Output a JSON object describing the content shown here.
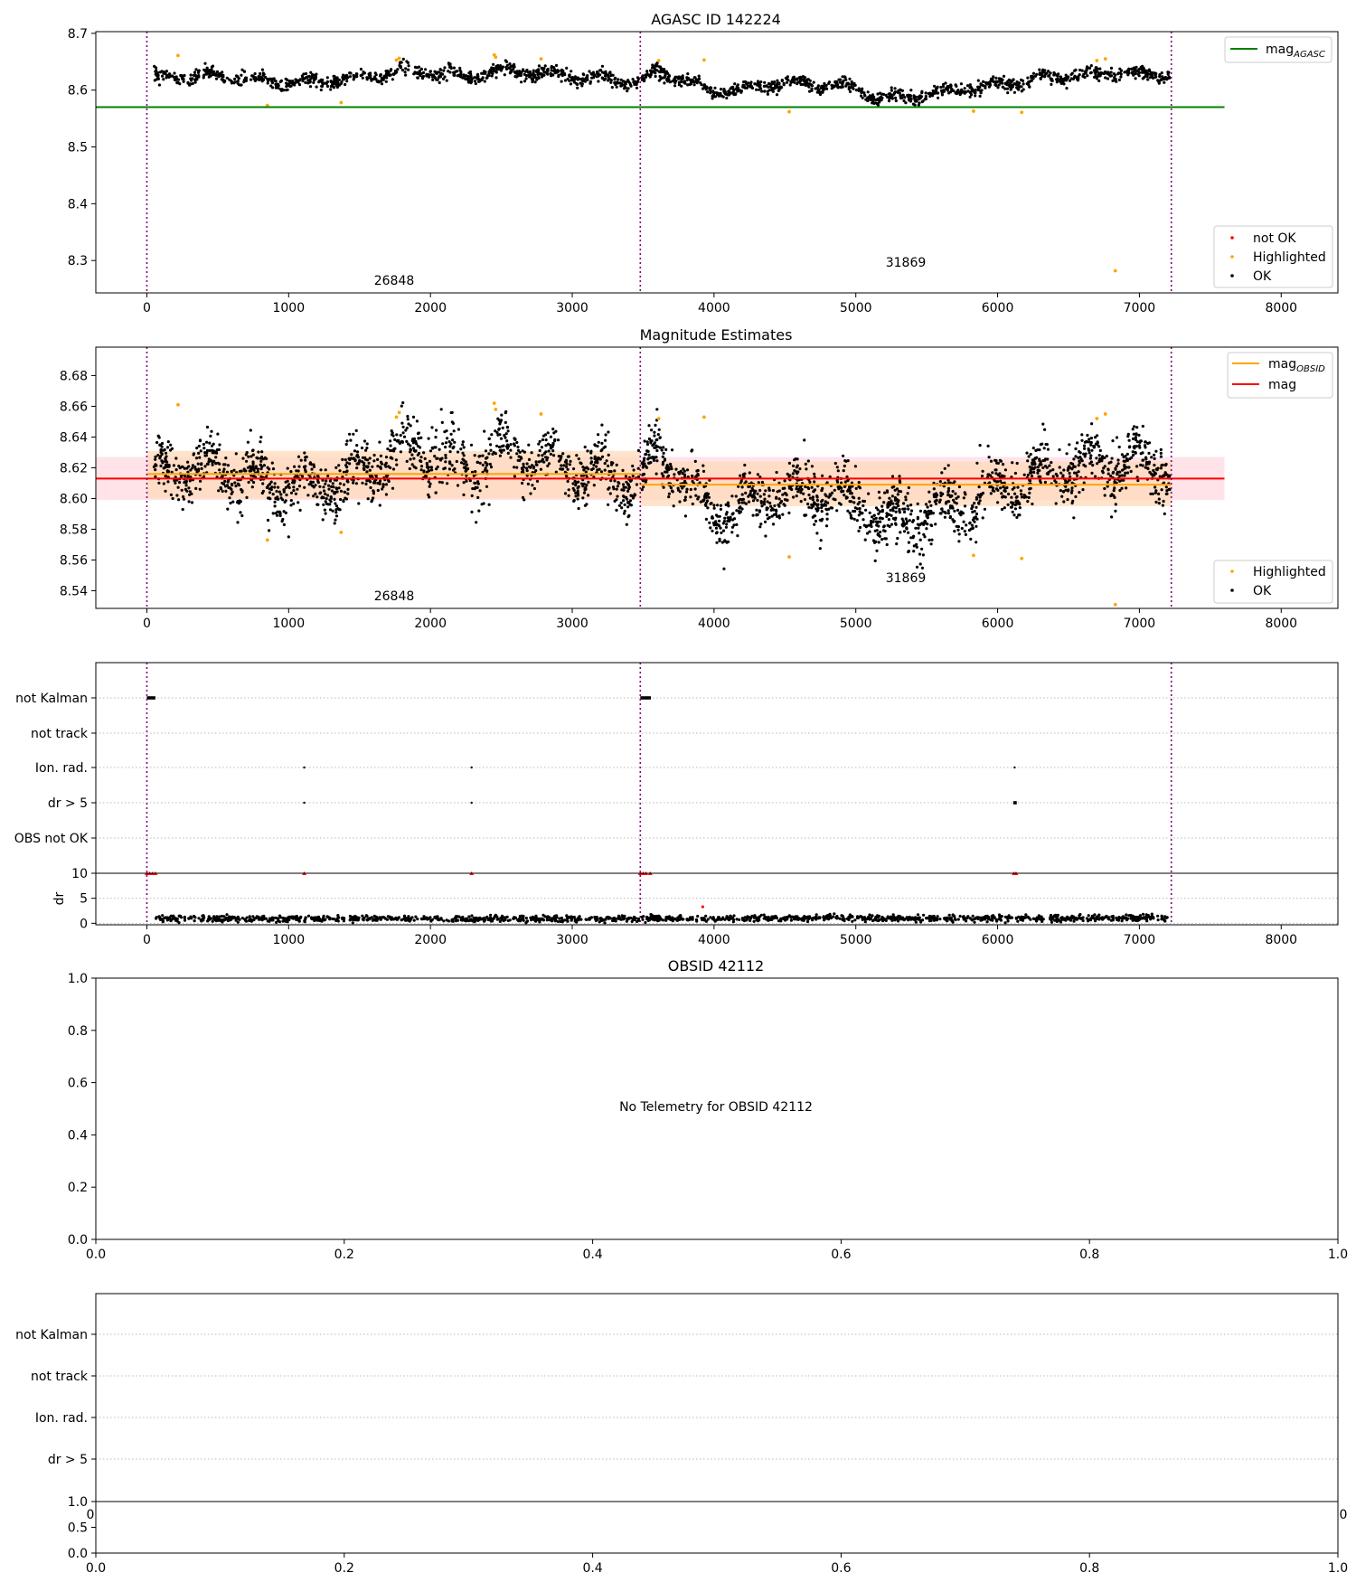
{
  "chart_data": [
    {
      "type": "scatter",
      "title": "AGASC ID 142224",
      "xlim": [
        -360,
        8400
      ],
      "ylim": [
        8.243,
        8.703
      ],
      "xticks": [
        "0",
        "1000",
        "2000",
        "3000",
        "4000",
        "5000",
        "6000",
        "7000",
        "8000"
      ],
      "xtick_values": [
        0,
        1000,
        2000,
        3000,
        4000,
        5000,
        6000,
        7000,
        8000
      ],
      "yticks": [
        "8.3",
        "8.4",
        "8.5",
        "8.6",
        "8.7"
      ],
      "ytick_values": [
        8.3,
        8.4,
        8.5,
        8.6,
        8.7
      ],
      "lines": [
        {
          "label": "mag",
          "label_sub": "AGASC",
          "y": 8.57,
          "x": [
            -360,
            7600
          ],
          "color": "#008000"
        }
      ],
      "obsid_boundaries": [
        0,
        3480,
        7225
      ],
      "obsid_labels": [
        {
          "text": "26848",
          "x": 1740,
          "y": 8.265
        },
        {
          "text": "31869",
          "x": 5350,
          "y": 8.297
        }
      ],
      "legends": [
        {
          "position": "upper-right",
          "entries": [
            {
              "label": "mag",
              "sub": "AGASC",
              "kind": "line",
              "color": "#008000"
            }
          ]
        },
        {
          "position": "lower-right",
          "entries": [
            {
              "label": "not OK",
              "kind": "dot",
              "color": "#ff0000"
            },
            {
              "label": "Highlighted",
              "kind": "dot",
              "color": "#ffa500"
            },
            {
              "label": "OK",
              "kind": "dot",
              "color": "#000000"
            }
          ]
        }
      ],
      "series": [
        {
          "name": "OK",
          "color": "#000000",
          "segments": [
            {
              "x_start": 50,
              "x_end": 3470,
              "n": 900,
              "profile": [
                [
                  50,
                  8.622
                ],
                [
                  500,
                  8.625
                ],
                [
                  1000,
                  8.612
                ],
                [
                  1500,
                  8.62
                ],
                [
                  1800,
                  8.635
                ],
                [
                  2300,
                  8.625
                ],
                [
                  2500,
                  8.635
                ],
                [
                  3000,
                  8.625
                ],
                [
                  3470,
                  8.615
                ]
              ],
              "spread": 0.011
            },
            {
              "x_start": 3490,
              "x_end": 7215,
              "n": 1000,
              "profile": [
                [
                  3490,
                  8.615
                ],
                [
                  3600,
                  8.635
                ],
                [
                  4000,
                  8.597
                ],
                [
                  4500,
                  8.612
                ],
                [
                  4900,
                  8.607
                ],
                [
                  5200,
                  8.585
                ],
                [
                  5600,
                  8.595
                ],
                [
                  6000,
                  8.61
                ],
                [
                  6300,
                  8.62
                ],
                [
                  6800,
                  8.63
                ],
                [
                  7215,
                  8.625
                ]
              ],
              "spread": 0.011
            }
          ]
        },
        {
          "name": "Highlighted",
          "color": "#ffa500",
          "points": [
            [
              220,
              8.661
            ],
            [
              850,
              8.573
            ],
            [
              1370,
              8.578
            ],
            [
              1760,
              8.653
            ],
            [
              1780,
              8.656
            ],
            [
              2450,
              8.662
            ],
            [
              2460,
              8.658
            ],
            [
              2780,
              8.655
            ],
            [
              3610,
              8.652
            ],
            [
              3930,
              8.653
            ],
            [
              4530,
              8.562
            ],
            [
              5830,
              8.563
            ],
            [
              6170,
              8.561
            ],
            [
              6700,
              8.652
            ],
            [
              6760,
              8.655
            ],
            [
              6830,
              8.282
            ]
          ]
        }
      ]
    },
    {
      "type": "scatter",
      "title": "Magnitude Estimates",
      "xlim": [
        -360,
        8400
      ],
      "ylim": [
        8.5285,
        8.6985
      ],
      "xticks": [
        "0",
        "1000",
        "2000",
        "3000",
        "4000",
        "5000",
        "6000",
        "7000",
        "8000"
      ],
      "xtick_values": [
        0,
        1000,
        2000,
        3000,
        4000,
        5000,
        6000,
        7000,
        8000
      ],
      "yticks": [
        "8.54",
        "8.56",
        "8.58",
        "8.60",
        "8.62",
        "8.64",
        "8.66",
        "8.68"
      ],
      "ytick_values": [
        8.54,
        8.56,
        8.58,
        8.6,
        8.62,
        8.64,
        8.66,
        8.68
      ],
      "lines": [
        {
          "label": "mag",
          "y": 8.613,
          "x": [
            -360,
            7600
          ],
          "color": "#ff0000",
          "band": [
            8.599,
            8.627
          ],
          "band_color": "#ffc0cb"
        },
        {
          "label": "mag",
          "label_sub": "OBSID",
          "segments": [
            {
              "x": [
                0,
                3480
              ],
              "y": 8.616,
              "band": [
                8.6,
                8.631
              ]
            },
            {
              "x": [
                3480,
                7225
              ],
              "y": 8.609,
              "band": [
                8.595,
                8.624
              ]
            }
          ],
          "color": "#ffa500",
          "band_color": "#ffdab9"
        }
      ],
      "obsid_boundaries": [
        0,
        3480,
        7225
      ],
      "obsid_labels": [
        {
          "text": "26848",
          "x": 1740,
          "y": 8.5335
        },
        {
          "text": "31869",
          "x": 5350,
          "y": 8.546
        }
      ],
      "legends": [
        {
          "position": "upper-right",
          "entries": [
            {
              "label": "mag",
              "sub": "OBSID",
              "kind": "line",
              "color": "#ffa500"
            },
            {
              "label": "mag",
              "kind": "line",
              "color": "#ff0000"
            }
          ]
        },
        {
          "position": "lower-right",
          "entries": [
            {
              "label": "Highlighted",
              "kind": "dot",
              "color": "#ffa500"
            },
            {
              "label": "OK",
              "kind": "dot",
              "color": "#000000"
            }
          ]
        }
      ],
      "series": [
        {
          "name": "OK",
          "color": "#000000",
          "segments": [
            {
              "x_start": 50,
              "x_end": 3470,
              "n": 1300,
              "profile": [
                [
                  50,
                  8.617
                ],
                [
                  500,
                  8.62
                ],
                [
                  1000,
                  8.605
                ],
                [
                  1500,
                  8.615
                ],
                [
                  1800,
                  8.632
                ],
                [
                  2300,
                  8.62
                ],
                [
                  2500,
                  8.632
                ],
                [
                  3000,
                  8.62
                ],
                [
                  3470,
                  8.61
                ]
              ],
              "spread": 0.018
            },
            {
              "x_start": 3490,
              "x_end": 7215,
              "n": 1500,
              "profile": [
                [
                  3490,
                  8.61
                ],
                [
                  3600,
                  8.632
                ],
                [
                  4000,
                  8.59
                ],
                [
                  4500,
                  8.605
                ],
                [
                  4900,
                  8.6
                ],
                [
                  5200,
                  8.585
                ],
                [
                  5600,
                  8.59
                ],
                [
                  6000,
                  8.605
                ],
                [
                  6300,
                  8.615
                ],
                [
                  6800,
                  8.625
                ],
                [
                  7215,
                  8.62
                ]
              ],
              "spread": 0.018
            }
          ]
        },
        {
          "name": "Highlighted",
          "color": "#ffa500",
          "points": [
            [
              220,
              8.661
            ],
            [
              850,
              8.573
            ],
            [
              1370,
              8.578
            ],
            [
              1760,
              8.653
            ],
            [
              1780,
              8.656
            ],
            [
              2450,
              8.662
            ],
            [
              2460,
              8.658
            ],
            [
              2780,
              8.655
            ],
            [
              3610,
              8.652
            ],
            [
              3930,
              8.653
            ],
            [
              4530,
              8.562
            ],
            [
              5830,
              8.563
            ],
            [
              6170,
              8.561
            ],
            [
              6700,
              8.652
            ],
            [
              6760,
              8.655
            ],
            [
              6830,
              8.531
            ]
          ]
        }
      ]
    },
    {
      "type": "scatter",
      "xlim": [
        -360,
        8400
      ],
      "xticks": [
        "0",
        "1000",
        "2000",
        "3000",
        "4000",
        "5000",
        "6000",
        "7000",
        "8000"
      ],
      "xtick_values": [
        0,
        1000,
        2000,
        3000,
        4000,
        5000,
        6000,
        7000,
        8000
      ],
      "flag_rows": [
        "not Kalman",
        "not track",
        "Ion. rad.",
        "dr > 5",
        "OBS not OK"
      ],
      "flag_marks": [
        {
          "row": "not Kalman",
          "x_start": 0,
          "x_end": 60
        },
        {
          "row": "not Kalman",
          "x_start": 3480,
          "x_end": 3555
        },
        {
          "row": "Ion. rad.",
          "x": 1110
        },
        {
          "row": "Ion. rad.",
          "x": 2290
        },
        {
          "row": "Ion. rad.",
          "x": 6120
        },
        {
          "row": "dr > 5",
          "x": 1110
        },
        {
          "row": "dr > 5",
          "x": 2290
        },
        {
          "row": "dr > 5",
          "x_start": 6110,
          "x_end": 6135
        }
      ],
      "obsid_boundaries": [
        0,
        3480,
        7225
      ],
      "dr": {
        "ylabel": "dr",
        "ylim": [
          -0.3,
          10
        ],
        "yticks": [
          "0",
          "5",
          "10"
        ],
        "ytick_values": [
          0,
          5,
          10
        ],
        "clipped_points": [
          [
            0,
            10
          ],
          [
            20,
            10
          ],
          [
            40,
            10
          ],
          [
            60,
            10
          ],
          [
            1110,
            10
          ],
          [
            2290,
            10
          ],
          [
            3480,
            10
          ],
          [
            3500,
            10
          ],
          [
            3520,
            10
          ],
          [
            3550,
            10
          ],
          [
            6115,
            10
          ],
          [
            6130,
            10
          ]
        ],
        "outliers": [
          [
            3920,
            3.3
          ]
        ],
        "segments": [
          {
            "x_start": 50,
            "x_end": 3470,
            "n": 650,
            "level": 0.9,
            "spread": 0.6
          },
          {
            "x_start": 3490,
            "x_end": 7215,
            "n": 720,
            "level": 1.0,
            "spread": 0.65
          }
        ]
      }
    },
    {
      "type": "scatter",
      "title": "OBSID 42112",
      "xlim": [
        0,
        1
      ],
      "ylim": [
        0,
        1
      ],
      "xticks": [
        "0.0",
        "0.2",
        "0.4",
        "0.6",
        "0.8",
        "1.0"
      ],
      "xtick_values": [
        0,
        0.2,
        0.4,
        0.6,
        0.8,
        1.0
      ],
      "yticks": [
        "0.0",
        "0.2",
        "0.4",
        "0.6",
        "0.8",
        "1.0"
      ],
      "ytick_values": [
        0,
        0.2,
        0.4,
        0.6,
        0.8,
        1.0
      ],
      "annotation": "No Telemetry for OBSID 42112"
    },
    {
      "type": "scatter",
      "flag_rows": [
        "not Kalman",
        "not track",
        "Ion. rad.",
        "dr > 5"
      ],
      "xticks_hidden_partial": [
        "0",
        "0"
      ],
      "sub_axis": {
        "ylim": [
          0,
          1
        ],
        "yticks": [
          "0.0",
          "0.5",
          "1.0"
        ],
        "ytick_values": [
          0,
          0.5,
          1.0
        ],
        "xticks": [
          "0.0",
          "0.2",
          "0.4",
          "0.6",
          "0.8",
          "1.0"
        ],
        "xtick_values": [
          0,
          0.2,
          0.4,
          0.6,
          0.8,
          1.0
        ]
      }
    }
  ]
}
